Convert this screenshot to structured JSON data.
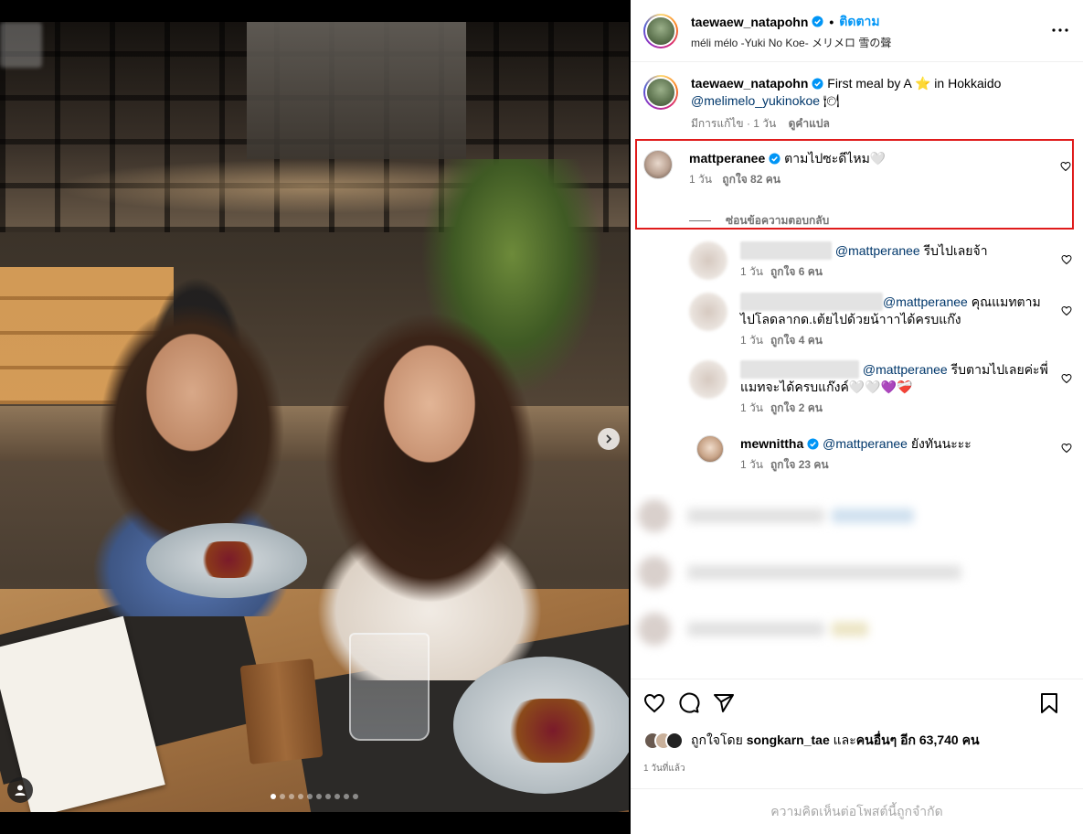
{
  "post": {
    "author": "taewaew_natapohn",
    "follow_label": "ติดตาม",
    "dot": "•",
    "audio": "méli mélo -Yuki No Koe- メリメロ 雪の聲",
    "more_icon": "more-icon",
    "caption": {
      "text": "First meal by A",
      "star": "⭐",
      "location": "in Hokkaido",
      "mention": "@melimelo_yukinokoe",
      "mention_emoji": "🍽",
      "edited": "มีการแก้ไข",
      "time": "1 วัน",
      "translate": "ดูคำแปล"
    },
    "media": {
      "slide_count": 10,
      "active_slide": 1,
      "next_icon": "chevron-right-icon",
      "user_tag_icon": "user-tag-icon"
    }
  },
  "comments": [
    {
      "user": "mattperanee",
      "verified": true,
      "text": "ตามไปซะดีไหม🤍",
      "time": "1 วัน",
      "likes": "ถูกใจ 82 คน",
      "hide_replies": "ซ่อนข้อความตอบกลับ",
      "highlighted": true
    }
  ],
  "replies": [
    {
      "mention": "@mattperanee",
      "text": "รีบไปเลยจ้า",
      "time": "1 วัน",
      "likes": "ถูกใจ 6 คน"
    },
    {
      "mention": "@mattperanee",
      "text": "คุณแมทตาม",
      "text2": "ไปโลดลากด.เต้ยไปด้วยน้าาาได้ครบแก๊ง",
      "time": "1 วัน",
      "likes": "ถูกใจ 4 คน"
    },
    {
      "mention": "@mattperanee",
      "text": "รีบตามไปเลยค่ะพี่",
      "text2": "แมทจะได้ครบแก๊งค์🤍🤍💜❤️‍🩹",
      "time": "1 วัน",
      "likes": "ถูกใจ 2 คน"
    },
    {
      "user": "mewnittha",
      "verified": true,
      "mention": "@mattperanee",
      "text": "ยังทันนะะะ",
      "time": "1 วัน",
      "likes": "ถูกใจ 23 คน"
    }
  ],
  "actions": {
    "liked_by_prefix": "ถูกใจโดย",
    "liked_by_user": "songkarn_tae",
    "liked_by_and": "และ",
    "liked_by_others": "คนอื่นๆ",
    "liked_by_count": "อีก 63,740 คน",
    "time_ago": "1 วันที่แล้ว",
    "comments_restricted": "ความคิดเห็นต่อโพสต์นี้ถูกจำกัด"
  },
  "colors": {
    "link_blue": "#0095f6",
    "mention": "#00376b",
    "highlight_border": "#e01b1b",
    "verified": "#0095f6"
  }
}
